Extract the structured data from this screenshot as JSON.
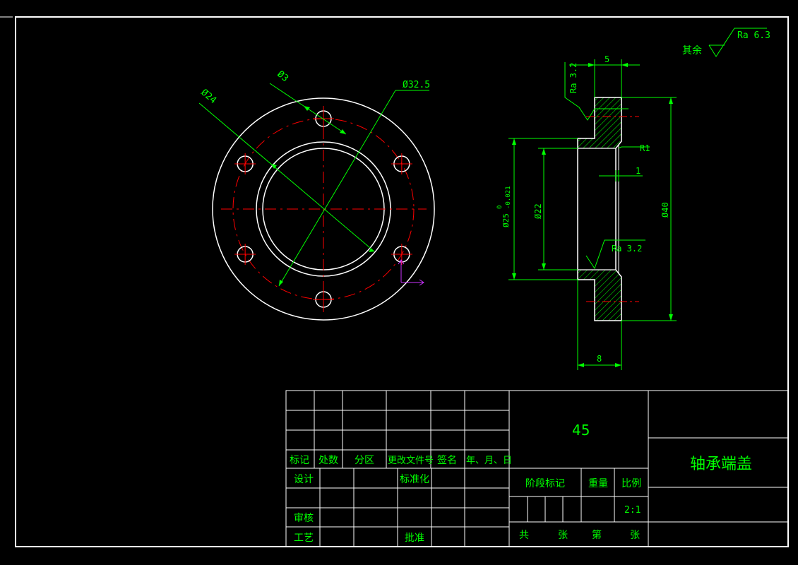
{
  "colors": {
    "outline": "#ffffff",
    "dimension": "#00ff00",
    "center_line": "#ff0000",
    "ucs": "#cc33ff",
    "background": "#000000"
  },
  "drawing": {
    "front_view": {
      "dim_hole": "Ø3",
      "dim_inner": "Ø24",
      "dim_pcd": "Ø32.5"
    },
    "section_view": {
      "dim_top": "5",
      "dim_bottom": "8",
      "dim_radius": "R1",
      "dim_step": "1",
      "dim_bore": "Ø22",
      "dim_outer": "Ø40",
      "dim_spigot": "Ø25",
      "dim_tol_upper": "0",
      "dim_tol_lower": "-0.021",
      "roughness_1": "Ra 3.2",
      "roughness_2": "Ra 3.2"
    },
    "general_roughness": {
      "label": "其余",
      "value": "Ra 6.3"
    }
  },
  "title_block": {
    "material": "45",
    "part_name": "轴承端盖",
    "headers": {
      "mark": "标记",
      "count": "处数",
      "zone": "分区",
      "doc_no": "更改文件号",
      "sign": "签名",
      "date": "年、月、日"
    },
    "design": "设计",
    "standardize": "标准化",
    "review": "审核",
    "process": "工艺",
    "approve": "批准",
    "stage_mark": "阶段标记",
    "weight": "重量",
    "scale_label": "比例",
    "scale_value": "2:1",
    "total": "共",
    "sheet1": "张",
    "nth": "第",
    "sheet2": "张"
  }
}
